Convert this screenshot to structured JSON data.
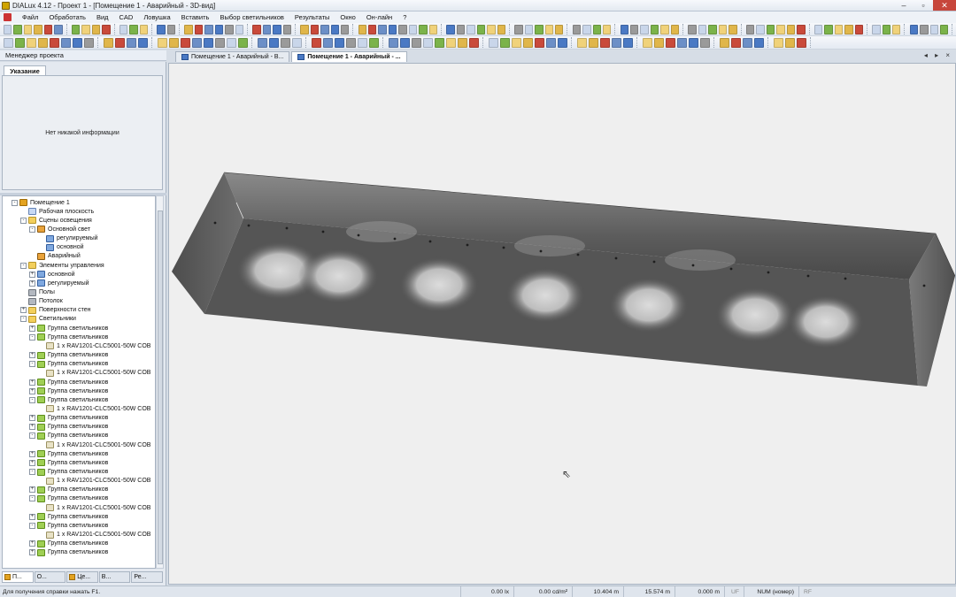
{
  "window": {
    "title": "DIALux 4.12 - Проект 1 - [Помещение 1 - Аварийный - 3D-вид]",
    "controls": [
      "–",
      "▫",
      "✕"
    ]
  },
  "menu": [
    "Файл",
    "Обработать",
    "Вид",
    "CAD",
    "Ловушка",
    "Вставить",
    "Выбор светильников",
    "Результаты",
    "Окно",
    "Он-лайн",
    "?"
  ],
  "left": {
    "header": "Менеджер проекта",
    "hint_tab": "Указание",
    "hint_text": "Нет никакой информации",
    "tree": [
      {
        "level": 0,
        "exp": "-",
        "icon": "room",
        "label": "Помещение 1"
      },
      {
        "level": 1,
        "exp": "",
        "icon": "plane",
        "label": "Рабочая плоскость"
      },
      {
        "level": 1,
        "exp": "-",
        "icon": "folder",
        "label": "Сцены освещения"
      },
      {
        "level": 2,
        "exp": "-",
        "icon": "scene",
        "label": "Основной свет"
      },
      {
        "level": 3,
        "exp": "",
        "icon": "ctrl",
        "label": "регулируемый"
      },
      {
        "level": 3,
        "exp": "",
        "icon": "ctrl",
        "label": "основной"
      },
      {
        "level": 2,
        "exp": "",
        "icon": "scene",
        "label": "Аварийный"
      },
      {
        "level": 1,
        "exp": "-",
        "icon": "folder",
        "label": "Элементы управления"
      },
      {
        "level": 2,
        "exp": "+",
        "icon": "ctrl",
        "label": "основной"
      },
      {
        "level": 2,
        "exp": "+",
        "icon": "ctrl",
        "label": "регулируемый"
      },
      {
        "level": 1,
        "exp": "",
        "icon": "surf",
        "label": "Полы"
      },
      {
        "level": 1,
        "exp": "",
        "icon": "surf",
        "label": "Потолок"
      },
      {
        "level": 1,
        "exp": "+",
        "icon": "folder",
        "label": "Поверхности стен"
      },
      {
        "level": 1,
        "exp": "-",
        "icon": "folder",
        "label": "Светильники"
      },
      {
        "level": 2,
        "exp": "+",
        "icon": "group",
        "label": "Группа светильников"
      },
      {
        "level": 2,
        "exp": "-",
        "icon": "group",
        "label": "Группа светильников"
      },
      {
        "level": 3,
        "exp": "",
        "icon": "lum",
        "label": "1 x   RAV1201-CLC5001-50W COB"
      },
      {
        "level": 2,
        "exp": "+",
        "icon": "group",
        "label": "Группа светильников"
      },
      {
        "level": 2,
        "exp": "-",
        "icon": "group",
        "label": "Группа светильников"
      },
      {
        "level": 3,
        "exp": "",
        "icon": "lum",
        "label": "1 x   RAV1201-CLC5001-50W COB"
      },
      {
        "level": 2,
        "exp": "+",
        "icon": "group",
        "label": "Группа светильников"
      },
      {
        "level": 2,
        "exp": "+",
        "icon": "group",
        "label": "Группа светильников"
      },
      {
        "level": 2,
        "exp": "-",
        "icon": "group",
        "label": "Группа светильников"
      },
      {
        "level": 3,
        "exp": "",
        "icon": "lum",
        "label": "1 x   RAV1201-CLC5001-50W COB"
      },
      {
        "level": 2,
        "exp": "+",
        "icon": "group",
        "label": "Группа светильников"
      },
      {
        "level": 2,
        "exp": "+",
        "icon": "group",
        "label": "Группа светильников"
      },
      {
        "level": 2,
        "exp": "-",
        "icon": "group",
        "label": "Группа светильников"
      },
      {
        "level": 3,
        "exp": "",
        "icon": "lum",
        "label": "1 x   RAV1201-CLC5001-50W COB"
      },
      {
        "level": 2,
        "exp": "+",
        "icon": "group",
        "label": "Группа светильников"
      },
      {
        "level": 2,
        "exp": "+",
        "icon": "group",
        "label": "Группа светильников"
      },
      {
        "level": 2,
        "exp": "-",
        "icon": "group",
        "label": "Группа светильников"
      },
      {
        "level": 3,
        "exp": "",
        "icon": "lum",
        "label": "1 x   RAV1201-CLC5001-50W COB"
      },
      {
        "level": 2,
        "exp": "+",
        "icon": "group",
        "label": "Группа светильников"
      },
      {
        "level": 2,
        "exp": "-",
        "icon": "group",
        "label": "Группа светильников"
      },
      {
        "level": 3,
        "exp": "",
        "icon": "lum",
        "label": "1 x   RAV1201-CLC5001-50W COB"
      },
      {
        "level": 2,
        "exp": "+",
        "icon": "group",
        "label": "Группа светильников"
      },
      {
        "level": 2,
        "exp": "-",
        "icon": "group",
        "label": "Группа светильников"
      },
      {
        "level": 3,
        "exp": "",
        "icon": "lum",
        "label": "1 x   RAV1201-CLC5001-50W COB"
      },
      {
        "level": 2,
        "exp": "+",
        "icon": "group",
        "label": "Группа светильников"
      },
      {
        "level": 2,
        "exp": "+",
        "icon": "group",
        "label": "Группа светильников"
      }
    ],
    "bottom_tabs": [
      "П...",
      "О...",
      "Це...",
      "В...",
      "Ре..."
    ]
  },
  "doc_tabs": [
    {
      "label": "Помещение 1 - Аварийный - В...",
      "active": false
    },
    {
      "label": "Помещение 1 - Аварийный - ...",
      "active": true
    }
  ],
  "nav_arrows": "◂ ▸ ×",
  "status": {
    "help": "Для получения справки нажать F1.",
    "lux": "0.00 lx",
    "cd": "0.00 cd/m²",
    "x": "10.404 m",
    "y": "15.574 m",
    "z": "0.000 m",
    "uf": "UF",
    "num": "NUM (номер)",
    "rf": "RF"
  },
  "toolbar_colors": [
    "#c9d6ea",
    "#e0b64a",
    "#4a79c4",
    "#7bb34a",
    "#c94a3b",
    "#9a9a9a",
    "#f0d27a",
    "#6c8fc7"
  ]
}
